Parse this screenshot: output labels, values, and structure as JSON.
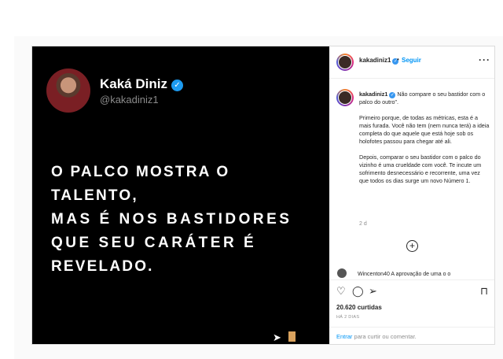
{
  "media": {
    "name": "Kaká Diniz",
    "handle": "@kakadiniz1",
    "quote_lines": [
      "O PALCO MOSTRA O TALENTO,",
      "MAS É NOS BASTIDORES",
      "QUE SEU CARÁTER É",
      "REVELADO."
    ],
    "verified_color": "#1d9bf0"
  },
  "header": {
    "username": "kakadiniz1",
    "separator": "•",
    "follow_label": "Seguir",
    "more_label": "···"
  },
  "caption": {
    "username": "kakadiniz1",
    "paragraphs": [
      "Não compare o seu bastidor com o palco do outro”.",
      "Primeiro porque, de todas as métricas, esta é a mais furada. Você não tem (nem nunca terá) a ideia completa do que aquele que está hoje sob os holofotes passou para chegar até ali.",
      "Depois, comparar o seu bastidor com o palco do vizinho é uma crueldade com você. Te incute um sofrimento desnecessário e recorrente, uma vez que todos os dias surge um novo Número 1."
    ],
    "time": "2 d"
  },
  "comment_peek": "Wincenton40 A aprovação de uma o o",
  "actions": {
    "likes": "20.620 curtidas",
    "ago": "HÁ 2 DIAS"
  },
  "comment_box": {
    "link": "Entrar",
    "placeholder": "para curtir ou comentar."
  },
  "colors": {
    "link": "#0095f6",
    "background": "#fafafa"
  }
}
